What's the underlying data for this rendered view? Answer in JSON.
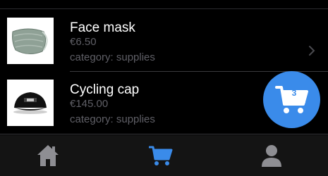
{
  "products": [
    {
      "title": "Face mask",
      "price": "€6.50",
      "category": "category: supplies",
      "icon": "face-mask-image"
    },
    {
      "title": "Cycling cap",
      "price": "€145.00",
      "category": "category: supplies",
      "icon": "cycling-cap-image"
    }
  ],
  "cart": {
    "count": "3",
    "icon": "cart-icon"
  },
  "tabs": [
    {
      "name": "home",
      "icon": "home-icon",
      "active": false
    },
    {
      "name": "cart",
      "icon": "cart-icon",
      "active": true
    },
    {
      "name": "profile",
      "icon": "person-icon",
      "active": false
    }
  ],
  "colors": {
    "accent": "#3a8bea",
    "inactive_tab": "#8e8e93",
    "background": "#000000",
    "secondary_text": "#5f5f66"
  }
}
